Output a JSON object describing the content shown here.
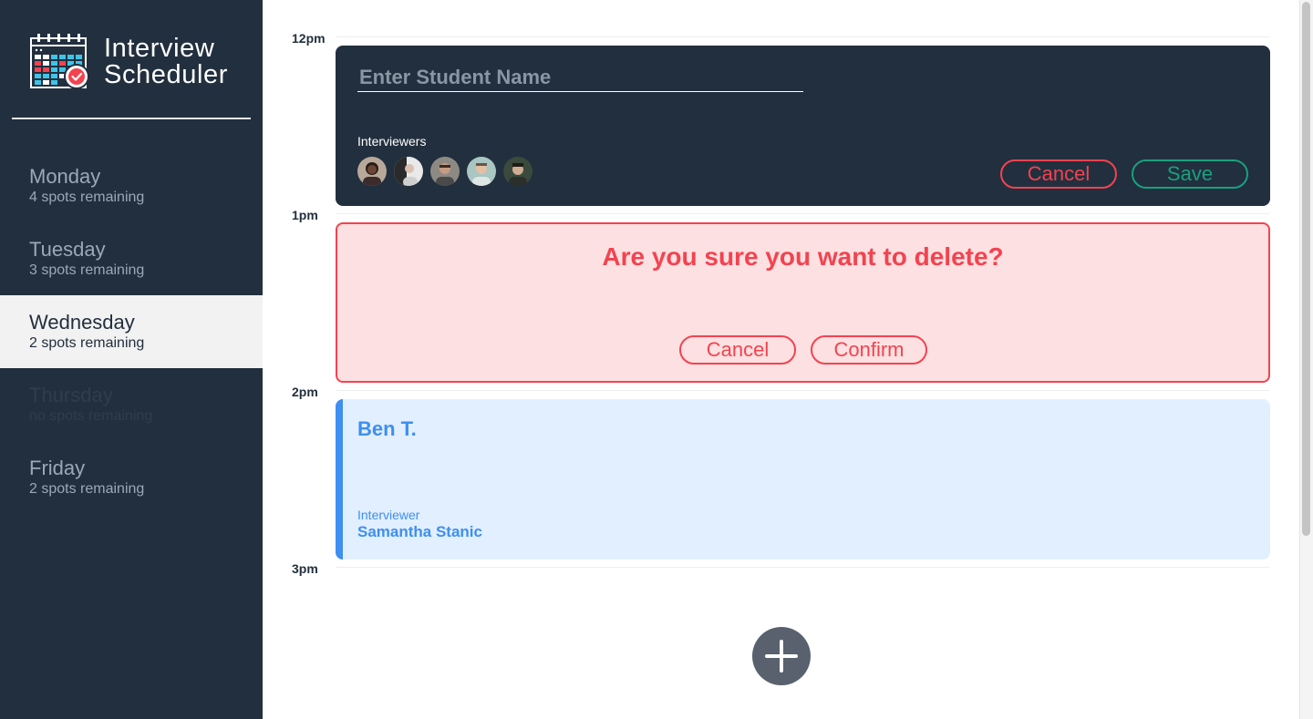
{
  "brand": {
    "line1": "Interview",
    "line2": "Scheduler"
  },
  "days": [
    {
      "name": "Monday",
      "spots": "4 spots remaining",
      "state": "normal"
    },
    {
      "name": "Tuesday",
      "spots": "3 spots remaining",
      "state": "normal"
    },
    {
      "name": "Wednesday",
      "spots": "2 spots remaining",
      "state": "selected"
    },
    {
      "name": "Thursday",
      "spots": "no spots remaining",
      "state": "full"
    },
    {
      "name": "Friday",
      "spots": "2 spots remaining",
      "state": "normal"
    }
  ],
  "times": [
    "12pm",
    "1pm",
    "2pm",
    "3pm"
  ],
  "form": {
    "student_placeholder": "Enter Student Name",
    "student_value": "",
    "interviewers_label": "Interviewers",
    "cancel_label": "Cancel",
    "save_label": "Save"
  },
  "confirm": {
    "message": "Are you sure you want to delete?",
    "cancel_label": "Cancel",
    "confirm_label": "Confirm"
  },
  "appointment": {
    "student": "Ben T.",
    "interviewer_label": "Interviewer",
    "interviewer_name": "Samantha Stanic"
  },
  "colors": {
    "sidebar_bg": "#222f3e",
    "danger": "#f3434f",
    "success": "#18a17e",
    "info": "#3d8ff0",
    "add_button": "#58616d"
  },
  "icons": {
    "logo": "calendar-check-icon",
    "add": "plus-icon"
  }
}
